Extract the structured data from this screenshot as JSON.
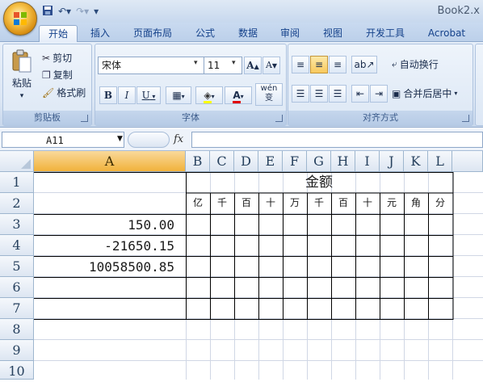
{
  "window": {
    "title": "Book2.x"
  },
  "quick_access": {
    "save_icon": "save-icon",
    "undo_icon": "undo-icon",
    "redo_icon": "redo-icon",
    "customize_icon": "customize-icon"
  },
  "tabs": [
    "开始",
    "插入",
    "页面布局",
    "公式",
    "数据",
    "审阅",
    "视图",
    "开发工具",
    "Acrobat"
  ],
  "clipboard": {
    "paste": "粘贴",
    "cut": "剪切",
    "copy": "复制",
    "format_painter": "格式刷",
    "label": "剪贴板"
  },
  "font": {
    "name": "宋体",
    "size": "11",
    "bold": "B",
    "italic": "I",
    "underline": "U",
    "label": "字体",
    "grow": "A",
    "shrink": "A",
    "wen": "wén",
    "wen_char": "变"
  },
  "alignment": {
    "wrap_text": "自动换行",
    "merge_center": "合并后居中",
    "label": "对齐方式"
  },
  "formula_bar": {
    "name_box": "A11",
    "fx": "fx",
    "formula": ""
  },
  "columns": [
    "A",
    "B",
    "C",
    "D",
    "E",
    "F",
    "G",
    "H",
    "I",
    "J",
    "K",
    "L"
  ],
  "rows": [
    "1",
    "2",
    "3",
    "4",
    "5",
    "6",
    "7",
    "8",
    "9",
    "10"
  ],
  "sheet": {
    "header_merged": "金额",
    "units": [
      "亿",
      "千",
      "百",
      "十",
      "万",
      "千",
      "百",
      "十",
      "元",
      "角",
      "分"
    ],
    "amounts": [
      "150.00",
      "-21650.15",
      "10058500.85"
    ]
  }
}
